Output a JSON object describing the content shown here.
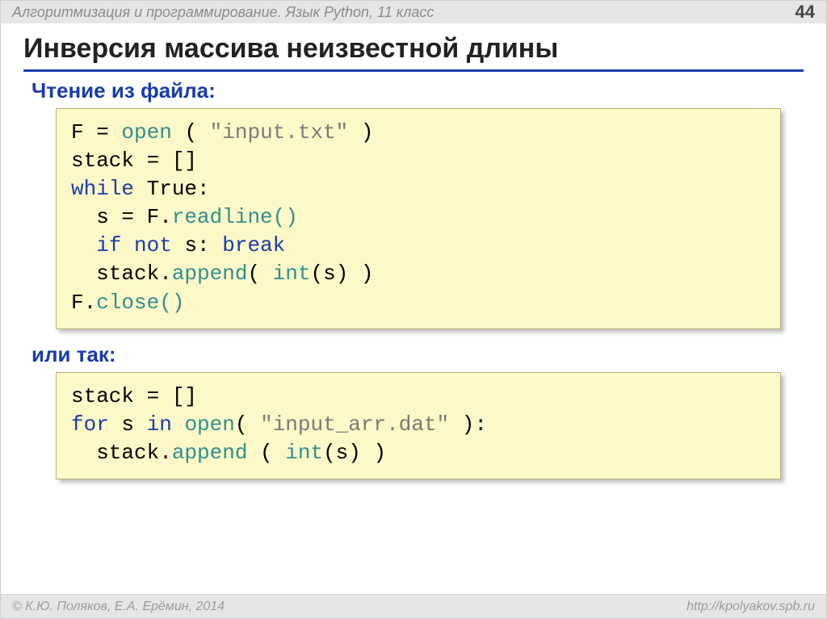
{
  "header": {
    "subject": "Алгоритмизация и программирование. Язык Python, 11 класс",
    "page_number": "44"
  },
  "title": "Инверсия массива неизвестной длины",
  "section1_label": "Чтение из файла:",
  "section2_label": "или так:",
  "code1": {
    "l1a": "F = ",
    "l1b": "open",
    "l1c": " ( ",
    "l1d": "\"input.txt\"",
    "l1e": " )",
    "l2": "stack = []",
    "l3a": "while",
    "l3b": " True:",
    "l4a": "  s = F.",
    "l4b": "readline()",
    "l5a": "  ",
    "l5b": "if not",
    "l5c": " s: ",
    "l5d": "break",
    "l6a": "  stack.",
    "l6b": "append",
    "l6c": "( ",
    "l6d": "int",
    "l6e": "(s) )",
    "l7a": "F.",
    "l7b": "close()"
  },
  "code2": {
    "l1": "stack = []",
    "l2a": "for",
    "l2b": " s ",
    "l2c": "in",
    "l2d": " ",
    "l2e": "open",
    "l2f": "( ",
    "l2g": "\"input_arr.dat\"",
    "l2h": " ):",
    "l3a": "  stack.",
    "l3b": "append",
    "l3c": " ( ",
    "l3d": "int",
    "l3e": "(s) )"
  },
  "footer": {
    "copyright": "© К.Ю. Поляков, Е.А. Ерёмин, 2014",
    "url": "http://kpolyakov.spb.ru"
  }
}
